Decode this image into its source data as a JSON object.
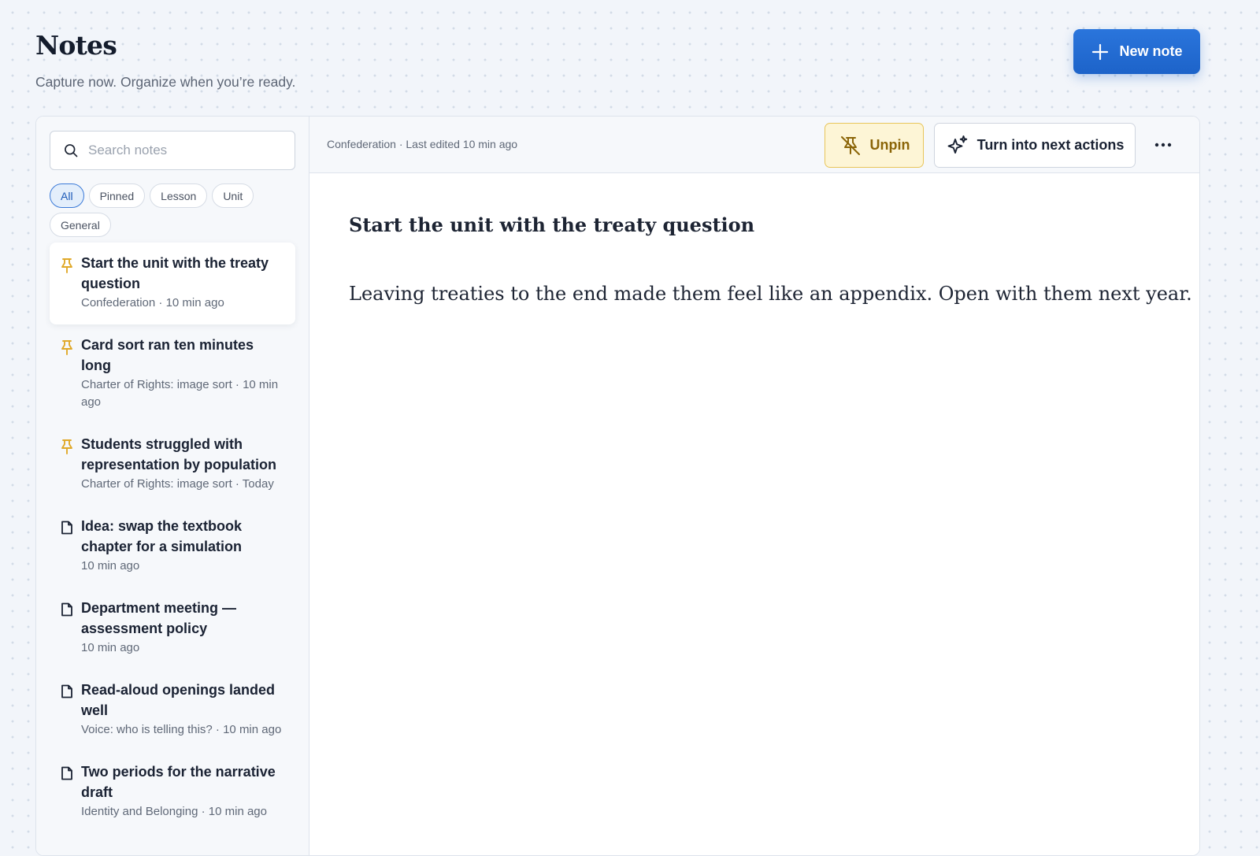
{
  "header": {
    "title": "Notes",
    "subtitle": "Capture now. Organize when you’re ready.",
    "new_note_label": "New note"
  },
  "search": {
    "placeholder": "Search notes",
    "value": ""
  },
  "filters": [
    {
      "label": "All",
      "active": true
    },
    {
      "label": "Pinned",
      "active": false
    },
    {
      "label": "Lesson",
      "active": false
    },
    {
      "label": "Unit",
      "active": false
    },
    {
      "label": "General",
      "active": false
    }
  ],
  "notes": [
    {
      "title": "Start the unit with the treaty question",
      "meta": "Confederation · 10 min ago",
      "pinned": true,
      "selected": true
    },
    {
      "title": "Card sort ran ten minutes long",
      "meta": "Charter of Rights: image sort · 10 min ago",
      "pinned": true,
      "selected": false
    },
    {
      "title": "Students struggled with representation by population",
      "meta": "Charter of Rights: image sort · Today",
      "pinned": true,
      "selected": false
    },
    {
      "title": "Idea: swap the textbook chapter for a simulation",
      "meta": "10 min ago",
      "pinned": false,
      "selected": false
    },
    {
      "title": "Department meeting — assessment policy",
      "meta": "10 min ago",
      "pinned": false,
      "selected": false
    },
    {
      "title": "Read-aloud openings landed well",
      "meta": "Voice: who is telling this? · 10 min ago",
      "pinned": false,
      "selected": false
    },
    {
      "title": "Two periods for the narrative draft",
      "meta": "Identity and Belonging · 10 min ago",
      "pinned": false,
      "selected": false
    }
  ],
  "editor": {
    "meta": "Confederation · Last edited 10 min ago",
    "unpin_label": "Unpin",
    "next_actions_label": "Turn into next actions",
    "heading": "Start the unit with the treaty question",
    "body": "Leaving treaties to the end made them feel like an appendix. Open with them next year."
  },
  "icons": {
    "new_note": "plus-icon",
    "search": "search-icon",
    "pinned_note": "pin-icon",
    "note": "document-icon",
    "unpin": "pin-off-icon",
    "next_actions": "sparkles-icon",
    "more": "more-horizontal-icon"
  },
  "colors": {
    "accent": "#1d63c9",
    "pin": "#e0a92a",
    "unpin_bg": "#fdf5d6",
    "unpin_text": "#8b6508"
  }
}
